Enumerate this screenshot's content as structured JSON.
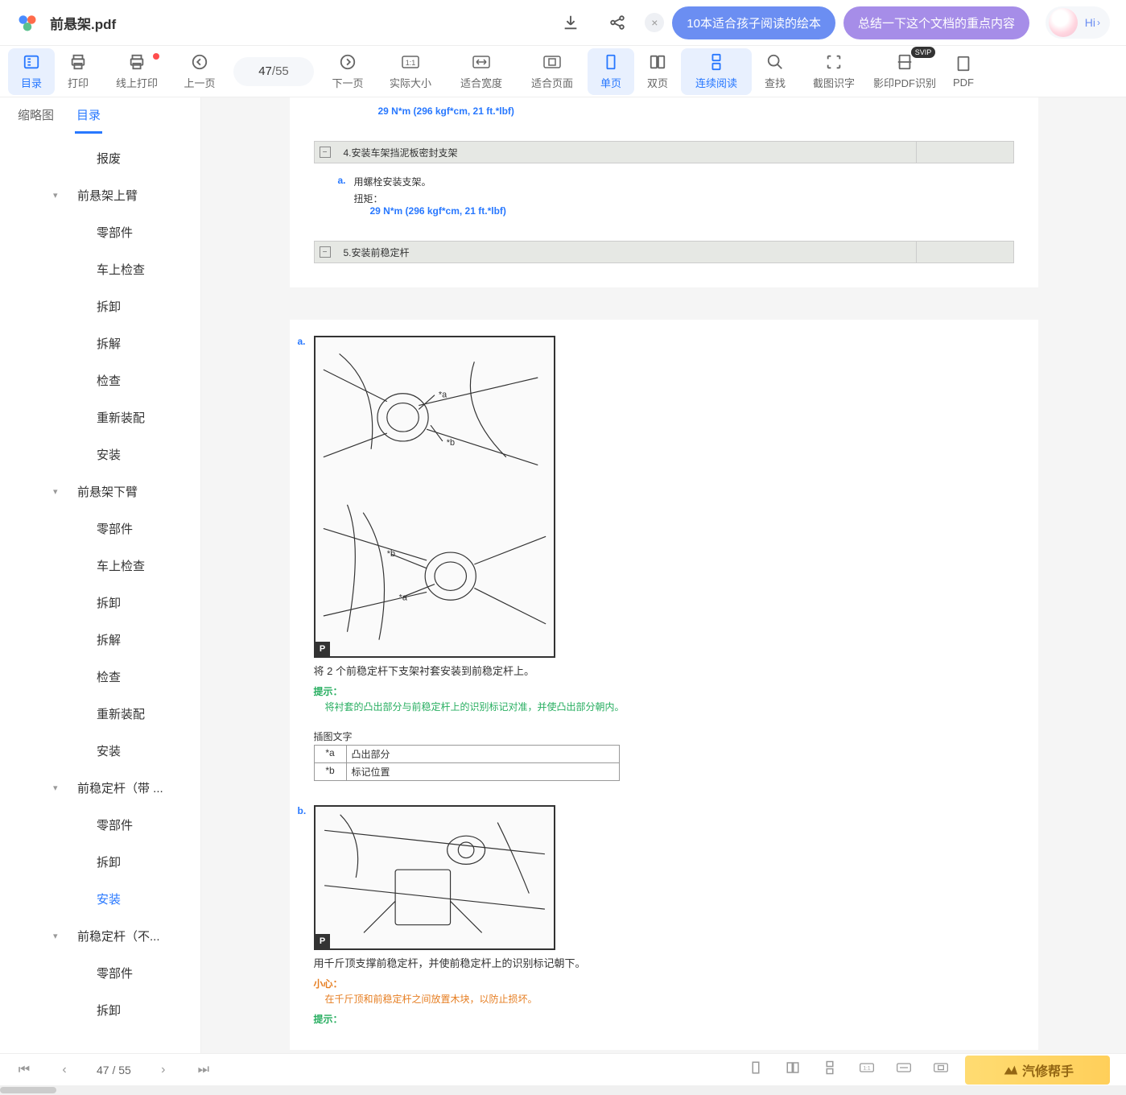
{
  "header": {
    "doc_title": "前悬架.pdf",
    "chip1": "10本适合孩子阅读的绘本",
    "chip2": "总结一下这个文档的重点内容",
    "hi": "Hi"
  },
  "toolbar": {
    "items": [
      {
        "label": "目录",
        "key": "toc"
      },
      {
        "label": "打印",
        "key": "print"
      },
      {
        "label": "线上打印",
        "key": "online-print"
      },
      {
        "label": "上一页",
        "key": "prev"
      },
      {
        "label": "下一页",
        "key": "next"
      },
      {
        "label": "实际大小",
        "key": "actual"
      },
      {
        "label": "适合宽度",
        "key": "fit-width"
      },
      {
        "label": "适合页面",
        "key": "fit-page"
      },
      {
        "label": "单页",
        "key": "single"
      },
      {
        "label": "双页",
        "key": "double"
      },
      {
        "label": "连续阅读",
        "key": "continuous"
      },
      {
        "label": "查找",
        "key": "find"
      },
      {
        "label": "截图识字",
        "key": "ocr"
      },
      {
        "label": "影印PDF识别",
        "key": "scan"
      },
      {
        "label": "PDF",
        "key": "pdf"
      }
    ],
    "page_current": "47",
    "page_sep": " / ",
    "page_total": "55",
    "svip": "SVIP"
  },
  "sidebar": {
    "tabs": [
      "缩略图",
      "目录"
    ],
    "items": [
      {
        "label": "报废",
        "level": 2
      },
      {
        "label": "前悬架上臂",
        "level": 1,
        "expanded": true
      },
      {
        "label": "零部件",
        "level": 2
      },
      {
        "label": "车上检查",
        "level": 2
      },
      {
        "label": "拆卸",
        "level": 2
      },
      {
        "label": "拆解",
        "level": 2
      },
      {
        "label": "检查",
        "level": 2
      },
      {
        "label": "重新装配",
        "level": 2
      },
      {
        "label": "安装",
        "level": 2
      },
      {
        "label": "前悬架下臂",
        "level": 1,
        "expanded": true
      },
      {
        "label": "零部件",
        "level": 2
      },
      {
        "label": "车上检查",
        "level": 2
      },
      {
        "label": "拆卸",
        "level": 2
      },
      {
        "label": "拆解",
        "level": 2
      },
      {
        "label": "检查",
        "level": 2
      },
      {
        "label": "重新装配",
        "level": 2
      },
      {
        "label": "安装",
        "level": 2
      },
      {
        "label": "前稳定杆（带 ...",
        "level": 1,
        "expanded": true
      },
      {
        "label": "零部件",
        "level": 2
      },
      {
        "label": "拆卸",
        "level": 2
      },
      {
        "label": "安装",
        "level": 2,
        "current": true
      },
      {
        "label": "前稳定杆（不...",
        "level": 1,
        "expanded": true
      },
      {
        "label": "零部件",
        "level": 2
      },
      {
        "label": "拆卸",
        "level": 2
      }
    ]
  },
  "content": {
    "torque_top": "29 N*m (296 kgf*cm, 21 ft.*lbf)",
    "step4_title": "4.安装车架挡泥板密封支架",
    "step4_letter": "a.",
    "step4_text": "用螺栓安装支架。",
    "step4_torque_label": "扭矩：",
    "step4_torque_value": "29 N*m (296 kgf*cm, 21 ft.*lbf)",
    "step5_title": "5.安装前稳定杆",
    "page2": {
      "letter_a": "a.",
      "a_text": "将 2 个前稳定杆下支架衬套安装到前稳定杆上。",
      "hint_label": "提示：",
      "hint_text": "将衬套的凸出部分与前稳定杆上的识别标记对准，并使凸出部分朝内。",
      "caption_title": "插图文字",
      "captions": [
        {
          "k": "*a",
          "v": "凸出部分"
        },
        {
          "k": "*b",
          "v": "标记位置"
        }
      ],
      "letter_b": "b.",
      "b_text": "用千斤顶支撑前稳定杆，并使前稳定杆上的识别标记朝下。",
      "warn_label": "小心：",
      "warn_text": "在千斤顶和前稳定杆之间放置木块，以防止损坏。",
      "hint2_label": "提示："
    }
  },
  "footer": {
    "page_current": "47",
    "page_sep": " / ",
    "page_total": "55",
    "watermark": "汽修帮手"
  }
}
